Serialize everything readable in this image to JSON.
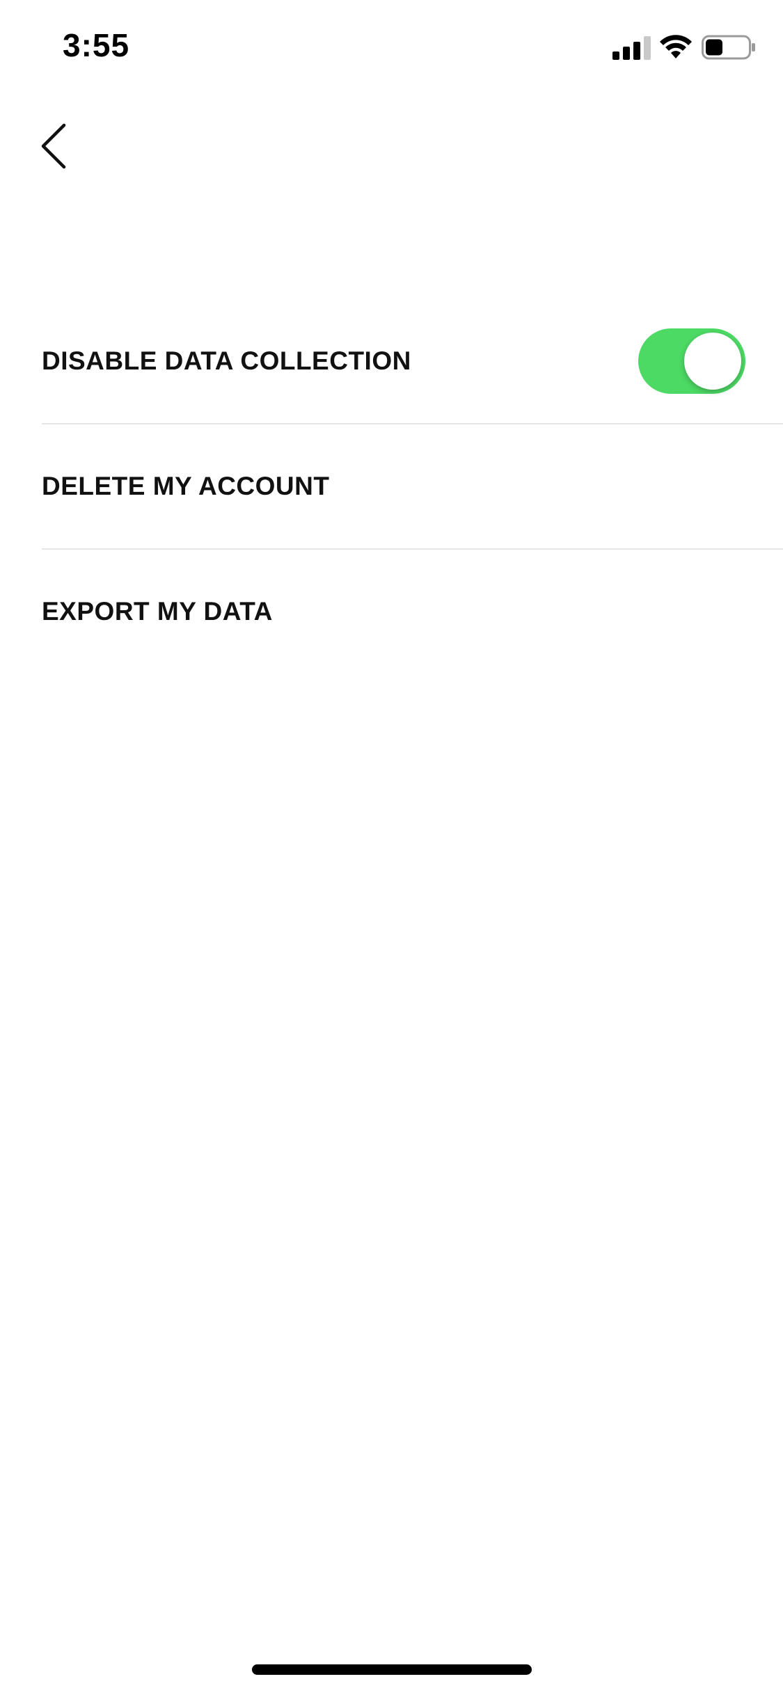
{
  "status_bar": {
    "time": "3:55",
    "signal_icon": "cellular-signal-icon",
    "wifi_icon": "wifi-icon",
    "battery_icon": "battery-icon",
    "battery_level": 0.4
  },
  "nav": {
    "back_icon": "chevron-left-icon"
  },
  "settings": {
    "items": [
      {
        "label": "DISABLE DATA COLLECTION",
        "toggle": true
      },
      {
        "label": "DELETE MY ACCOUNT"
      },
      {
        "label": "EXPORT MY DATA"
      }
    ]
  },
  "colors": {
    "toggle_on": "#4cd964",
    "divider": "#e6e6e6",
    "text": "#111111"
  }
}
